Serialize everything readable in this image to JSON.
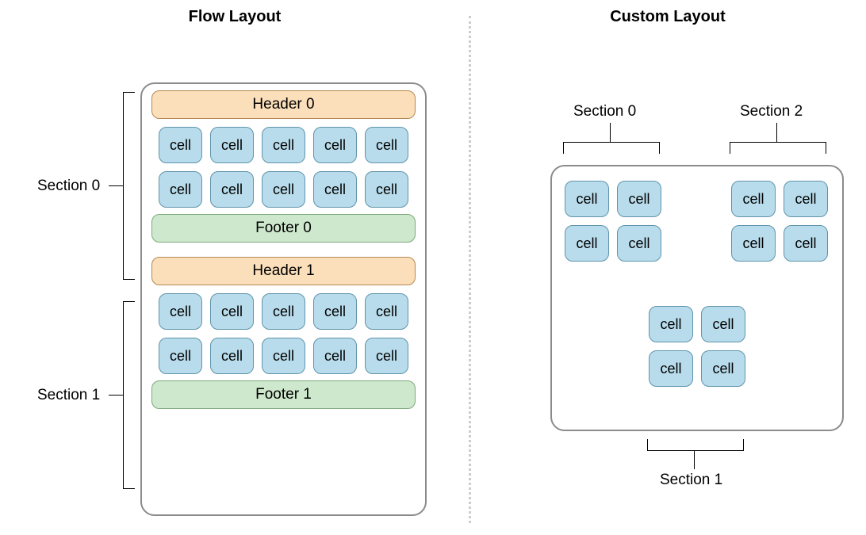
{
  "titles": {
    "flow": "Flow Layout",
    "custom": "Custom Layout"
  },
  "flow": {
    "sections": [
      {
        "label": "Section 0",
        "header": "Header 0",
        "footer": "Footer 0",
        "rows": [
          [
            "cell",
            "cell",
            "cell",
            "cell",
            "cell"
          ],
          [
            "cell",
            "cell",
            "cell",
            "cell",
            "cell"
          ]
        ]
      },
      {
        "label": "Section 1",
        "header": "Header 1",
        "footer": "Footer 1",
        "rows": [
          [
            "cell",
            "cell",
            "cell",
            "cell",
            "cell"
          ],
          [
            "cell",
            "cell",
            "cell",
            "cell",
            "cell"
          ]
        ]
      }
    ]
  },
  "custom": {
    "sections": [
      {
        "label": "Section 0",
        "rows": [
          [
            "cell",
            "cell"
          ],
          [
            "cell",
            "cell"
          ]
        ]
      },
      {
        "label": "Section 2",
        "rows": [
          [
            "cell",
            "cell"
          ],
          [
            "cell",
            "cell"
          ]
        ]
      },
      {
        "label": "Section 1",
        "rows": [
          [
            "cell",
            "cell"
          ],
          [
            "cell",
            "cell"
          ]
        ]
      }
    ]
  },
  "colors": {
    "header": "#fbdeba",
    "footer": "#cee8cd",
    "cell": "#b8dceb"
  }
}
